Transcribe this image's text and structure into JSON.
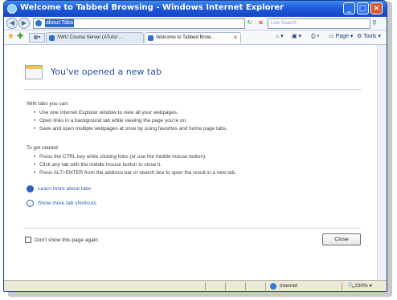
{
  "window": {
    "title": "Welcome to Tabbed Browsing - Windows Internet Explorer"
  },
  "address": {
    "url": "about:Tabs",
    "search_placeholder": "Live Search"
  },
  "tabs": [
    {
      "label": "SWU Course Server (ATutor ..."
    },
    {
      "label": "Welcome to Tabbed Brow..."
    }
  ],
  "toolbar": {
    "page_label": "Page",
    "tools_label": "Tools"
  },
  "content": {
    "heading": "You've opened a new tab",
    "with_tabs_intro": "With tabs you can:",
    "with_tabs_items": [
      "Use one Internet Explorer window to view all your webpages.",
      "Open links in a background tab while viewing the page you're on.",
      "Save and open multiple webpages at once by using favorites and home page tabs."
    ],
    "get_started_intro": "To get started:",
    "get_started_items": [
      "Press the CTRL key while clicking links (or use the middle mouse button).",
      "Click any tab with the middle mouse button to close it.",
      "Press ALT+ENTER from the address bar or search box to open the result in a new tab."
    ],
    "learn_more_link": "Learn more about tabs",
    "shortcuts_link": "Show more tab shortcuts",
    "dont_show_label": "Don't show this page again",
    "close_button": "Close"
  },
  "status": {
    "zone": "Internet",
    "zoom": "100%"
  }
}
